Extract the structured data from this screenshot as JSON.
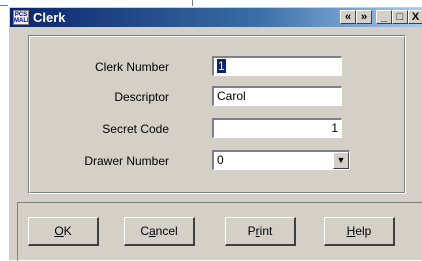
{
  "window": {
    "title": "Clerk",
    "icon_text": "PCS MALL",
    "controls": {
      "prev": "«",
      "next": "»",
      "minimize": "_",
      "maximize": "□",
      "close": "X"
    }
  },
  "form": {
    "clerk_number": {
      "label": "Clerk Number",
      "value": "1"
    },
    "descriptor": {
      "label": "Descriptor",
      "value": "Carol"
    },
    "secret_code": {
      "label": "Secret Code",
      "value": "1"
    },
    "drawer_number": {
      "label": "Drawer Number",
      "value": "0",
      "dropdown_icon": "▼"
    }
  },
  "buttons": {
    "ok": {
      "mnemonic": "O",
      "rest": "K"
    },
    "cancel": {
      "pre": "C",
      "mnemonic": "a",
      "rest": "ncel"
    },
    "print": {
      "pre": "P",
      "mnemonic": "r",
      "rest": "int"
    },
    "help": {
      "mnemonic": "H",
      "rest": "elp"
    }
  }
}
